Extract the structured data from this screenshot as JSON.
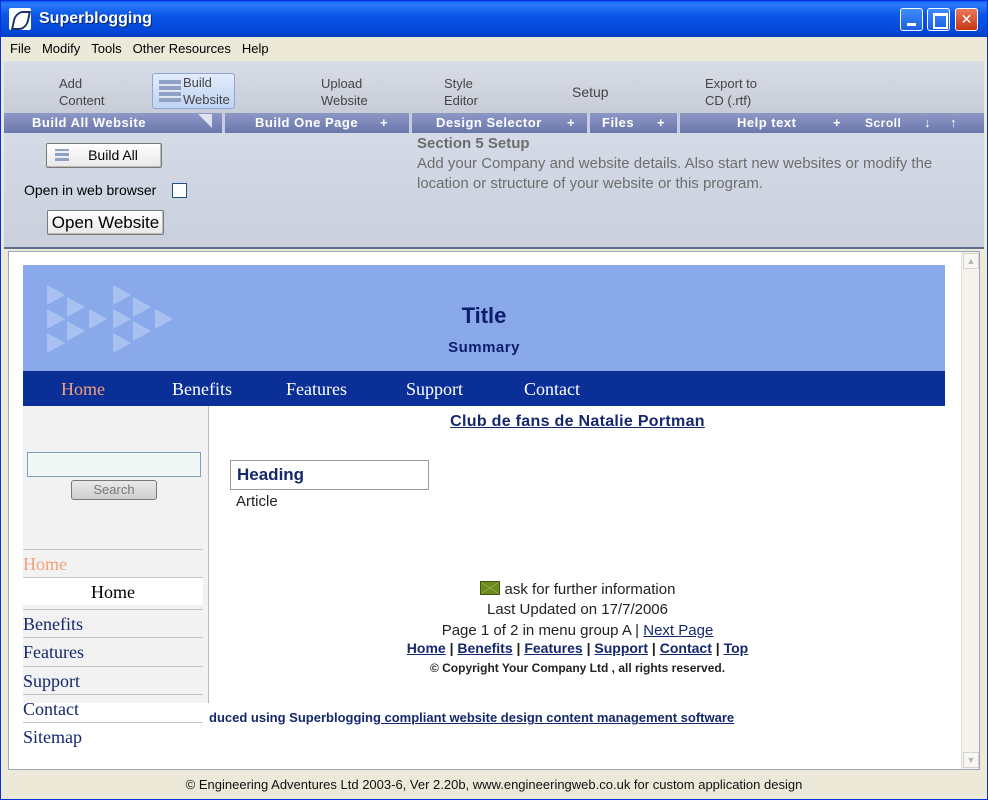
{
  "window": {
    "title": "Superblogging"
  },
  "menu": [
    "File",
    "Modify",
    "Tools",
    "Other Resources",
    "Help"
  ],
  "toolbar": {
    "tabs": [
      {
        "line1": "Add",
        "line2": "Content"
      },
      {
        "line1": "Build",
        "line2": "Website"
      },
      {
        "line1": "Upload",
        "line2": "Website"
      },
      {
        "line1": "Style",
        "line2": "Editor"
      },
      {
        "line1": "Setup",
        "line2": ""
      },
      {
        "line1": "Export to",
        "line2": "CD (.rtf)"
      }
    ]
  },
  "section_bar": {
    "build_all": "Build All Website",
    "build_one": "Build One Page",
    "design": "Design Selector",
    "files": "Files",
    "help": "Help text",
    "scroll": "Scroll",
    "down": "↓",
    "up": "↑"
  },
  "panel": {
    "build_all_button": "Build All",
    "open_in_browser_label": "Open in web browser",
    "open_website_button": "Open Website",
    "section_title": "Section 5 Setup",
    "section_desc": "Add your Company and website details. Also start new websites or modify the location or structure of your website or this program."
  },
  "site": {
    "title": "Title",
    "summary": "Summary",
    "nav": [
      "Home",
      "Benefits",
      "Features",
      "Support",
      "Contact"
    ],
    "search_button": "Search",
    "side": [
      "Home",
      "Home",
      "Benefits",
      "Features",
      "Support",
      "Contact",
      "Sitemap"
    ],
    "club_link": "Club de fans de Natalie Portman",
    "heading": "Heading",
    "article": "Article",
    "ask_info": "ask for further information",
    "last_updated": "Last Updated on 17/7/2006",
    "page_info": "Page 1 of 2 in menu group A",
    "next_page": "Next Page",
    "footer_links": [
      "Home",
      "Benefits",
      "Features",
      "Support",
      "Contact",
      "Top"
    ],
    "copyright": "© Copyright Your Company Ltd , all rights reserved.",
    "produced_text": "duced using Superblogging",
    "produced_link": " compliant website design content management software"
  },
  "status": "© Engineering Adventures Ltd 2003-6,  Ver 2.20b, www.engineeringweb.co.uk for custom application design"
}
